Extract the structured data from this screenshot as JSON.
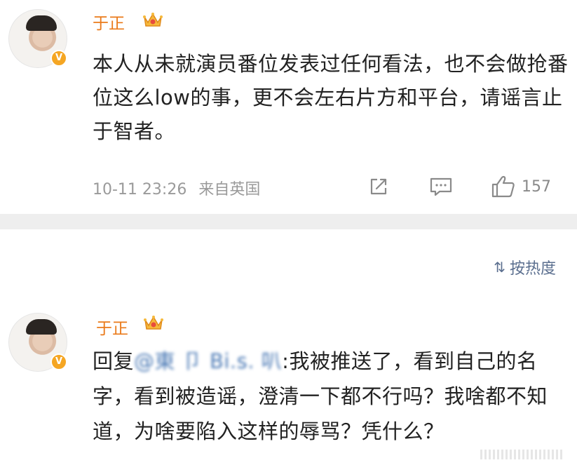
{
  "post": {
    "username": "于正",
    "text": "本人从未就演员番位发表过任何看法，也不会做抢番位这么low的事，更不会左右片方和平台，请谣言止于智者。",
    "time": "10-11 23:26",
    "source": "来自英国",
    "like_count": "157",
    "verified_badge": "V",
    "icons": {
      "repost": "share-icon",
      "comment": "comment-icon",
      "like": "thumbs-up-icon",
      "crown": "crown-icon"
    }
  },
  "sort": {
    "icon": "⇅",
    "label": "按热度"
  },
  "reply": {
    "username": "于正",
    "prefix": "回复",
    "mention": "@東 卩 Bi.s. 叭",
    "colon_text": ":我被推送了，看到自己的名字，看到被造谣，澄清一下都不行吗？我啥都不知道，为啥要陷入这样的辱骂？凭什么？",
    "verified_badge": "V"
  },
  "colors": {
    "username": "#ea7a1a",
    "meta": "#9a9a9a",
    "sort": "#5b6f8f",
    "mention": "#4a79b5",
    "divider": "#eeeeee"
  }
}
